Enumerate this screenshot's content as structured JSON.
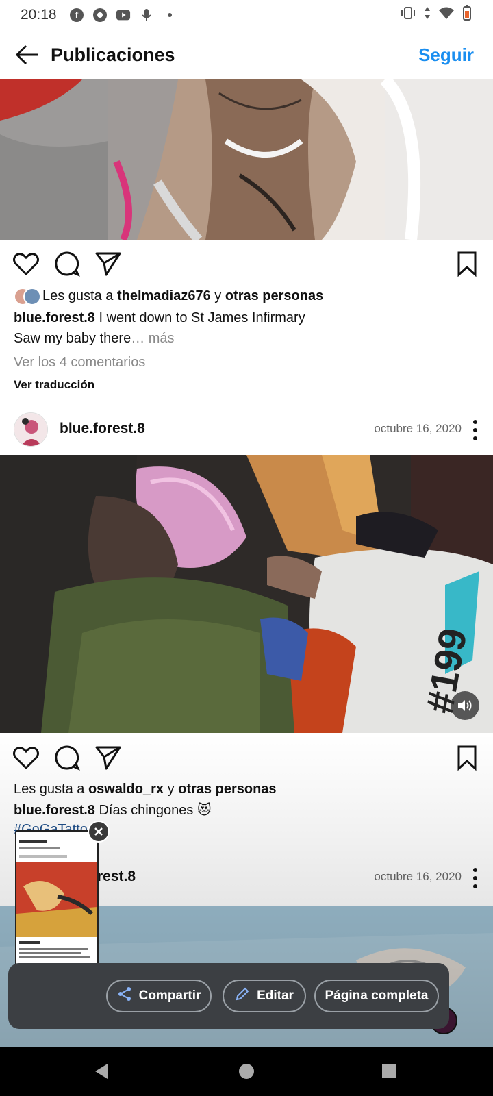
{
  "status_bar": {
    "time": "20:18"
  },
  "header": {
    "title": "Publicaciones",
    "follow_label": "Seguir"
  },
  "post1": {
    "likes_prefix": "Les gusta a ",
    "liker": "thelmadiaz676",
    "likes_join": " y ",
    "likes_others": "otras personas",
    "caption_user": "blue.forest.8",
    "caption_line1": " I went down to St James Infirmary",
    "caption_line2": "Saw my baby there",
    "caption_more": "… más",
    "comments_link": "Ver los 4 comentarios",
    "translate_link": "Ver traducción"
  },
  "post2": {
    "user": "blue.forest.8",
    "date": "octubre 16, 2020",
    "likes_prefix": "Les gusta a ",
    "liker": "oswaldo_rx",
    "likes_join": " y ",
    "likes_others": "otras personas",
    "caption_user": "blue.forest.8",
    "caption_text": " Días chingones 😻",
    "hashtag": "#GoGaTatto"
  },
  "post3": {
    "user_partial": "rest.8",
    "date": "octubre 16, 2020"
  },
  "screenshot_overlay": {
    "share_label": "Compartir",
    "edit_label": "Editar",
    "fullpage_label": "Página completa"
  },
  "colors": {
    "accent": "#1a8ef0",
    "panel": "#3c3f43"
  }
}
